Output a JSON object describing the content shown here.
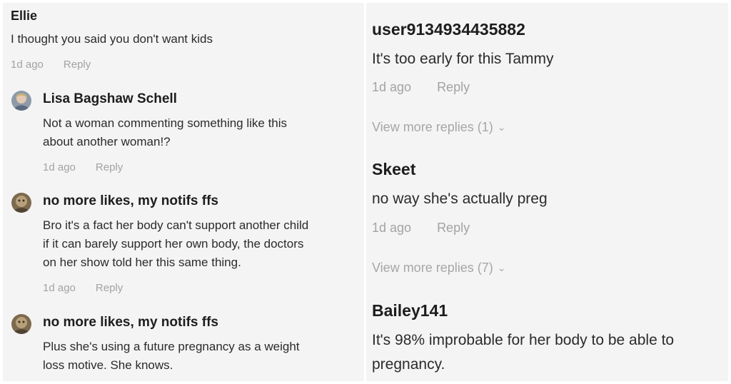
{
  "left": {
    "c1": {
      "author": "Ellie",
      "text": "I thought you said you don't want kids",
      "time": "1d ago",
      "reply": "Reply"
    },
    "c2": {
      "author": "Lisa Bagshaw Schell",
      "lines": [
        "Not a woman commenting something like this",
        "about another woman!?"
      ],
      "time": "1d ago",
      "reply": "Reply"
    },
    "c3": {
      "author": "no more likes, my notifs ffs",
      "lines": [
        "Bro it's a fact her body can't support another child",
        "if it can barely support her own body, the doctors",
        "on her show told her this same thing."
      ],
      "time": "1d ago",
      "reply": "Reply"
    },
    "c4": {
      "author": "no more likes, my notifs ffs",
      "lines": [
        "Plus she's using a future pregnancy as a weight",
        "loss motive. She knows."
      ]
    }
  },
  "right": {
    "c1": {
      "author": "user9134934435882",
      "text": "It's too early for this Tammy",
      "time": "1d ago",
      "reply": "Reply",
      "more": "View more replies (1)"
    },
    "c2": {
      "author": "Skeet",
      "text": "no way she's actually preg",
      "time": "1d ago",
      "reply": "Reply",
      "more": "View more replies (7)"
    },
    "c3": {
      "author": "Bailey141",
      "lines": [
        "It's 98% improbable for her body to be able to",
        "pregnancy."
      ]
    }
  },
  "icons": {
    "avatar": "user-avatar-icon",
    "chevron": "chevron-down-icon"
  }
}
